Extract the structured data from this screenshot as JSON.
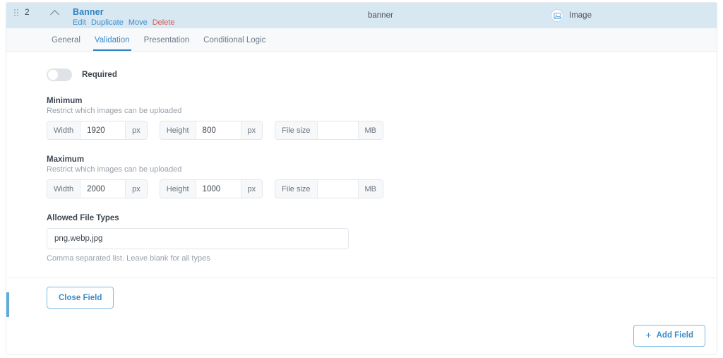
{
  "field": {
    "index": "2",
    "title": "Banner",
    "slug": "banner",
    "type_label": "Image",
    "type_icon": "image-icon",
    "collapse_icon": "chevron-up-icon",
    "drag_icon": "drag-handle-icon",
    "actions": [
      {
        "label": "Edit",
        "name": "edit"
      },
      {
        "label": "Duplicate",
        "name": "duplicate"
      },
      {
        "label": "Move",
        "name": "move"
      },
      {
        "label": "Delete",
        "name": "delete"
      }
    ]
  },
  "tabs": [
    {
      "label": "General",
      "active": false
    },
    {
      "label": "Validation",
      "active": true
    },
    {
      "label": "Presentation",
      "active": false
    },
    {
      "label": "Conditional Logic",
      "active": false
    }
  ],
  "validation": {
    "required": {
      "label": "Required",
      "enabled": false
    },
    "minimum": {
      "title": "Minimum",
      "subtitle": "Restrict which images can be uploaded",
      "width": {
        "addon": "Width",
        "value": "1920",
        "unit": "px"
      },
      "height": {
        "addon": "Height",
        "value": "800",
        "unit": "px"
      },
      "filesize": {
        "addon": "File size",
        "value": "",
        "unit": "MB"
      }
    },
    "maximum": {
      "title": "Maximum",
      "subtitle": "Restrict which images can be uploaded",
      "width": {
        "addon": "Width",
        "value": "2000",
        "unit": "px"
      },
      "height": {
        "addon": "Height",
        "value": "1000",
        "unit": "px"
      },
      "filesize": {
        "addon": "File size",
        "value": "",
        "unit": "MB"
      }
    },
    "file_types": {
      "label": "Allowed File Types",
      "value": "png,webp,jpg",
      "placeholder": "",
      "help": "Comma separated list. Leave blank for all types"
    }
  },
  "buttons": {
    "close_field": "Close Field",
    "add_field": "Add Field",
    "add_field_icon": "plus-icon"
  },
  "colors": {
    "accent": "#3a8dc8",
    "header_bg": "#d8e8f3",
    "stripe": "#5dacd8",
    "danger": "#d9534f"
  }
}
